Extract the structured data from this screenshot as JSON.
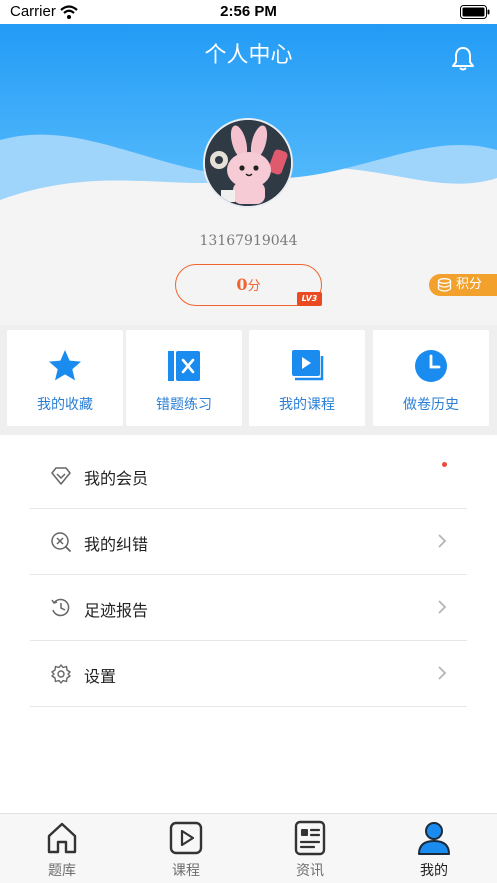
{
  "status_bar": {
    "carrier": "Carrier",
    "time": "2:56 PM"
  },
  "header": {
    "title": "个人中心",
    "bell_icon": "bell-icon"
  },
  "profile": {
    "avatar_icon": "rabbit-avatar",
    "phone": "13167919044",
    "score_value": "0",
    "score_unit": "分",
    "level_badge": "LV3",
    "points_label": "积分"
  },
  "grid": [
    {
      "label": "我的收藏",
      "icon": "star-icon"
    },
    {
      "label": "错题练习",
      "icon": "wrong-question-icon"
    },
    {
      "label": "我的课程",
      "icon": "course-icon"
    },
    {
      "label": "做卷历史",
      "icon": "clock-icon"
    }
  ],
  "menu": [
    {
      "label": "我的会员",
      "icon": "diamond-icon",
      "has_dot": true
    },
    {
      "label": "我的纠错",
      "icon": "search-error-icon"
    },
    {
      "label": "足迹报告",
      "icon": "history-icon"
    },
    {
      "label": "设置",
      "icon": "gear-icon"
    }
  ],
  "tabbar": {
    "active": "我的",
    "tabs": [
      {
        "label": "题库",
        "icon": "home-icon"
      },
      {
        "label": "课程",
        "icon": "play-icon"
      },
      {
        "label": "资讯",
        "icon": "news-icon"
      },
      {
        "label": "我的",
        "icon": "user-icon"
      }
    ]
  },
  "colors": {
    "accent_blue": "#2a7fd5",
    "header_gradient_start": "#1d9bf6",
    "score_orange": "#f0642f",
    "points_orange": "#f2a12d"
  }
}
